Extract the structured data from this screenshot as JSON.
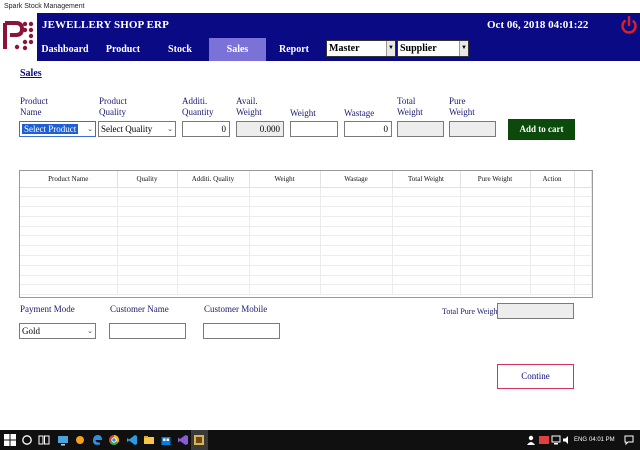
{
  "window": {
    "title": "Spark Stock Management"
  },
  "header": {
    "app_title": "JEWELLERY SHOP ERP",
    "datetime": "Oct 06, 2018 04:01:22"
  },
  "nav": {
    "items": [
      {
        "label": "Dashboard"
      },
      {
        "label": "Product"
      },
      {
        "label": "Stock"
      },
      {
        "label": "Sales",
        "active": true
      },
      {
        "label": "Report"
      }
    ],
    "master_select": "Master",
    "supplier_select": "Supplier"
  },
  "page": {
    "title": "Sales"
  },
  "form": {
    "product_name_label_1": "Product",
    "product_name_label_2": "Name",
    "product_name_value": "Select Product",
    "product_quality_label_1": "Product",
    "product_quality_label_2": "Quality",
    "product_quality_value": "Select Quality",
    "addl_quantity_label_1": "Additi.",
    "addl_quantity_label_2": "Quantity",
    "addl_quantity_value": "0",
    "avail_weight_label_1": "Avail.",
    "avail_weight_label_2": "Weight",
    "avail_weight_value": "0.000",
    "weight_label": "Weight",
    "weight_value": "",
    "wastage_label": "Wastage",
    "wastage_value": "0",
    "total_weight_label_1": "Total",
    "total_weight_label_2": "Weight",
    "total_weight_value": "",
    "pure_weight_label_1": "Pure",
    "pure_weight_label_2": "Weight",
    "pure_weight_value": "",
    "add_to_cart": "Add to cart"
  },
  "grid": {
    "columns": [
      "Product Name",
      "Quality",
      "Additi. Quality",
      "Weight",
      "Wastage",
      "Total Weight",
      "Pure Weight",
      "Action"
    ]
  },
  "payment": {
    "mode_label": "Payment Mode",
    "mode_value": "Gold",
    "customer_name_label": "Customer Name",
    "customer_name_value": "",
    "customer_mobile_label": "Customer Mobile",
    "customer_mobile_value": "",
    "total_pure_weight_label": "Total Pure Weight",
    "total_pure_weight_value": "",
    "continue": "Contine"
  },
  "taskbar": {
    "language": "ENG",
    "time": "04:01 PM"
  },
  "colors": {
    "header_bg": "#0a0a85",
    "nav_active": "#7b72d8",
    "cart_button": "#0b4a0b",
    "continue_border": "#d6325a",
    "logo": "#8b1538"
  }
}
